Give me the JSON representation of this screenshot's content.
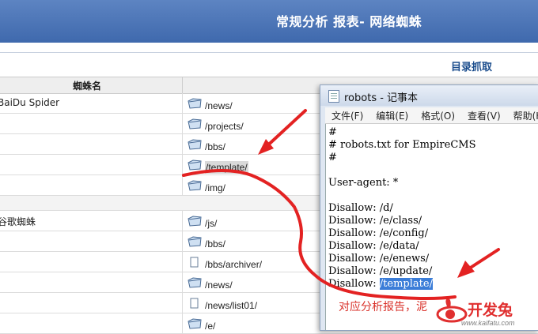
{
  "banner": {
    "title": "常规分析 报表- 网络蜘蛛"
  },
  "toolbar": {
    "link_label": "目录抓取"
  },
  "table": {
    "header": "蜘蛛名",
    "groups": [
      {
        "name": "BaiDu Spider",
        "paths": [
          "/news/",
          "/projects/",
          "/bbs/",
          "/template/",
          "/img/"
        ]
      },
      {
        "name": "谷歌蜘蛛",
        "paths": [
          "/js/",
          "/bbs/",
          "/bbs/archiver/",
          "/news/",
          "/news/list01/",
          "/e/"
        ]
      }
    ]
  },
  "notepad": {
    "title": "robots - 记事本",
    "menu": [
      "文件(F)",
      "编辑(E)",
      "格式(O)",
      "查看(V)",
      "帮助(H)"
    ],
    "lines": [
      "#",
      "# robots.txt for EmpireCMS",
      "#",
      "",
      "User-agent: *",
      "",
      "Disallow: /d/",
      "Disallow: /e/class/",
      "Disallow: /e/config/",
      "Disallow: /e/data/",
      "Disallow: /e/enews/",
      "Disallow: /e/update/"
    ],
    "last_line_prefix": "Disallow: ",
    "last_line_selected": "/template/"
  },
  "caption": "对应分析报告，泥",
  "logo": {
    "text": "开发兔",
    "url": "www.kaifatu.com"
  },
  "colors": {
    "banner": "#4a72b5",
    "annotation": "#e32222",
    "selection": "#3b7dd8"
  }
}
